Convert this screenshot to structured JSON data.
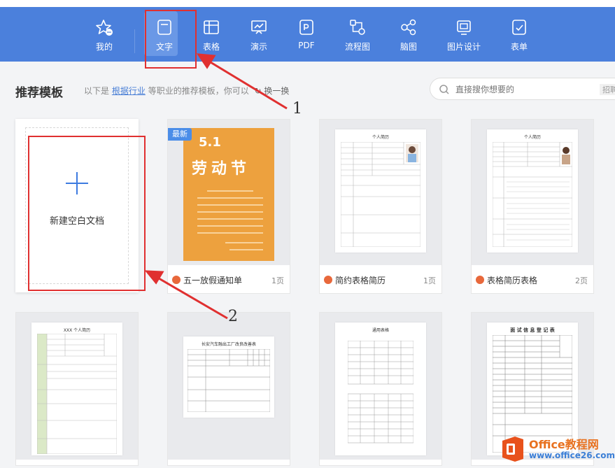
{
  "nav": {
    "items": [
      {
        "label": "我的",
        "icon": "star-icon"
      },
      {
        "label": "文字",
        "icon": "document-icon"
      },
      {
        "label": "表格",
        "icon": "table-icon"
      },
      {
        "label": "演示",
        "icon": "presentation-icon"
      },
      {
        "label": "PDF",
        "icon": "pdf-icon"
      },
      {
        "label": "流程图",
        "icon": "flowchart-icon"
      },
      {
        "label": "脑图",
        "icon": "mindmap-icon"
      },
      {
        "label": "图片设计",
        "icon": "image-design-icon"
      },
      {
        "label": "表单",
        "icon": "form-icon"
      }
    ],
    "active": "文字"
  },
  "section": {
    "title": "推荐模板",
    "subtitle_pre": "以下是",
    "subtitle_link": "根据行业",
    "subtitle_post": "等职业的推荐模板，你可以",
    "refresh_label": "换一换"
  },
  "search": {
    "placeholder": "直接搜你想要的",
    "hint": "招聘"
  },
  "new_card": {
    "label": "新建空白文档"
  },
  "templates": [
    {
      "name": "五一放假通知单",
      "pages": "1页",
      "badge": "最新",
      "poster_num": "5.1",
      "poster_title": "劳动节"
    },
    {
      "name": "简约表格简历",
      "pages": "1页",
      "doc_title": "个人简历"
    },
    {
      "name": "表格简历表格",
      "pages": "2页",
      "doc_title": "个人简历"
    },
    {
      "doc_title": "XXX 个人简历"
    },
    {
      "doc_title": "长安汽车融出工厂改良改善表"
    },
    {
      "doc_title": "通用表格"
    },
    {
      "doc_title": "面 试 信 息 登 记 表"
    }
  ],
  "annotations": {
    "one": "1",
    "two": "2"
  },
  "watermark": {
    "title": "Office教程网",
    "url": "www.office26.com"
  },
  "colors": {
    "nav_bg": "#4b80dc",
    "accent": "#3d7be0",
    "annotation": "#e03030",
    "badge": "#4b8de8",
    "poster": "#eda13e"
  }
}
